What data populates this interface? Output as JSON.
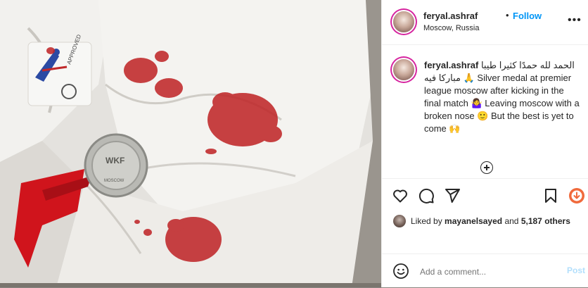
{
  "post": {
    "username": "feryal.ashraf",
    "separator": "•",
    "follow_label": "Follow",
    "location": "Moscow, Russia",
    "more_label": "•••"
  },
  "caption": {
    "username": "feryal.ashraf",
    "text": "الحمد لله حمدًا كثيرا طيبا مباركا فيه 🙏 Silver medal at premier league moscow after kicking in the final match 🤷‍♀️ Leaving moscow with a broken nose 🙂 But the best is yet to come 🙌"
  },
  "likes": {
    "prefix": "Liked by",
    "user": "mayanelsayed",
    "mid": "and",
    "others": "5,187 others"
  },
  "comment": {
    "placeholder": "Add a comment...",
    "post_label": "Post"
  },
  "icons": [
    "heart-icon",
    "comment-icon",
    "share-icon",
    "save-icon",
    "emoji-icon",
    "plus-circle-icon",
    "more-icon"
  ],
  "colors": {
    "accent": "#0095f6",
    "post_disabled": "#b2dffc",
    "text": "#262626",
    "muted": "#8e8e8e",
    "blood": "#c0282a",
    "ribbon": "#d0141c"
  }
}
